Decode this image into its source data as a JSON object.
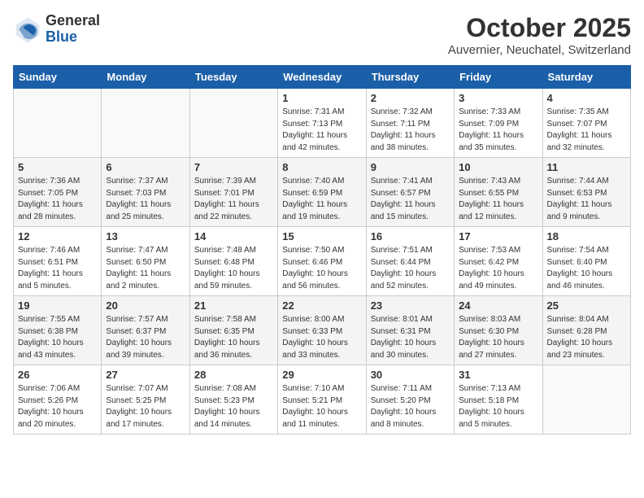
{
  "header": {
    "logo_general": "General",
    "logo_blue": "Blue",
    "month": "October 2025",
    "location": "Auvernier, Neuchatel, Switzerland"
  },
  "weekdays": [
    "Sunday",
    "Monday",
    "Tuesday",
    "Wednesday",
    "Thursday",
    "Friday",
    "Saturday"
  ],
  "weeks": [
    [
      {
        "day": "",
        "info": ""
      },
      {
        "day": "",
        "info": ""
      },
      {
        "day": "",
        "info": ""
      },
      {
        "day": "1",
        "info": "Sunrise: 7:31 AM\nSunset: 7:13 PM\nDaylight: 11 hours\nand 42 minutes."
      },
      {
        "day": "2",
        "info": "Sunrise: 7:32 AM\nSunset: 7:11 PM\nDaylight: 11 hours\nand 38 minutes."
      },
      {
        "day": "3",
        "info": "Sunrise: 7:33 AM\nSunset: 7:09 PM\nDaylight: 11 hours\nand 35 minutes."
      },
      {
        "day": "4",
        "info": "Sunrise: 7:35 AM\nSunset: 7:07 PM\nDaylight: 11 hours\nand 32 minutes."
      }
    ],
    [
      {
        "day": "5",
        "info": "Sunrise: 7:36 AM\nSunset: 7:05 PM\nDaylight: 11 hours\nand 28 minutes."
      },
      {
        "day": "6",
        "info": "Sunrise: 7:37 AM\nSunset: 7:03 PM\nDaylight: 11 hours\nand 25 minutes."
      },
      {
        "day": "7",
        "info": "Sunrise: 7:39 AM\nSunset: 7:01 PM\nDaylight: 11 hours\nand 22 minutes."
      },
      {
        "day": "8",
        "info": "Sunrise: 7:40 AM\nSunset: 6:59 PM\nDaylight: 11 hours\nand 19 minutes."
      },
      {
        "day": "9",
        "info": "Sunrise: 7:41 AM\nSunset: 6:57 PM\nDaylight: 11 hours\nand 15 minutes."
      },
      {
        "day": "10",
        "info": "Sunrise: 7:43 AM\nSunset: 6:55 PM\nDaylight: 11 hours\nand 12 minutes."
      },
      {
        "day": "11",
        "info": "Sunrise: 7:44 AM\nSunset: 6:53 PM\nDaylight: 11 hours\nand 9 minutes."
      }
    ],
    [
      {
        "day": "12",
        "info": "Sunrise: 7:46 AM\nSunset: 6:51 PM\nDaylight: 11 hours\nand 5 minutes."
      },
      {
        "day": "13",
        "info": "Sunrise: 7:47 AM\nSunset: 6:50 PM\nDaylight: 11 hours\nand 2 minutes."
      },
      {
        "day": "14",
        "info": "Sunrise: 7:48 AM\nSunset: 6:48 PM\nDaylight: 10 hours\nand 59 minutes."
      },
      {
        "day": "15",
        "info": "Sunrise: 7:50 AM\nSunset: 6:46 PM\nDaylight: 10 hours\nand 56 minutes."
      },
      {
        "day": "16",
        "info": "Sunrise: 7:51 AM\nSunset: 6:44 PM\nDaylight: 10 hours\nand 52 minutes."
      },
      {
        "day": "17",
        "info": "Sunrise: 7:53 AM\nSunset: 6:42 PM\nDaylight: 10 hours\nand 49 minutes."
      },
      {
        "day": "18",
        "info": "Sunrise: 7:54 AM\nSunset: 6:40 PM\nDaylight: 10 hours\nand 46 minutes."
      }
    ],
    [
      {
        "day": "19",
        "info": "Sunrise: 7:55 AM\nSunset: 6:38 PM\nDaylight: 10 hours\nand 43 minutes."
      },
      {
        "day": "20",
        "info": "Sunrise: 7:57 AM\nSunset: 6:37 PM\nDaylight: 10 hours\nand 39 minutes."
      },
      {
        "day": "21",
        "info": "Sunrise: 7:58 AM\nSunset: 6:35 PM\nDaylight: 10 hours\nand 36 minutes."
      },
      {
        "day": "22",
        "info": "Sunrise: 8:00 AM\nSunset: 6:33 PM\nDaylight: 10 hours\nand 33 minutes."
      },
      {
        "day": "23",
        "info": "Sunrise: 8:01 AM\nSunset: 6:31 PM\nDaylight: 10 hours\nand 30 minutes."
      },
      {
        "day": "24",
        "info": "Sunrise: 8:03 AM\nSunset: 6:30 PM\nDaylight: 10 hours\nand 27 minutes."
      },
      {
        "day": "25",
        "info": "Sunrise: 8:04 AM\nSunset: 6:28 PM\nDaylight: 10 hours\nand 23 minutes."
      }
    ],
    [
      {
        "day": "26",
        "info": "Sunrise: 7:06 AM\nSunset: 5:26 PM\nDaylight: 10 hours\nand 20 minutes."
      },
      {
        "day": "27",
        "info": "Sunrise: 7:07 AM\nSunset: 5:25 PM\nDaylight: 10 hours\nand 17 minutes."
      },
      {
        "day": "28",
        "info": "Sunrise: 7:08 AM\nSunset: 5:23 PM\nDaylight: 10 hours\nand 14 minutes."
      },
      {
        "day": "29",
        "info": "Sunrise: 7:10 AM\nSunset: 5:21 PM\nDaylight: 10 hours\nand 11 minutes."
      },
      {
        "day": "30",
        "info": "Sunrise: 7:11 AM\nSunset: 5:20 PM\nDaylight: 10 hours\nand 8 minutes."
      },
      {
        "day": "31",
        "info": "Sunrise: 7:13 AM\nSunset: 5:18 PM\nDaylight: 10 hours\nand 5 minutes."
      },
      {
        "day": "",
        "info": ""
      }
    ]
  ]
}
